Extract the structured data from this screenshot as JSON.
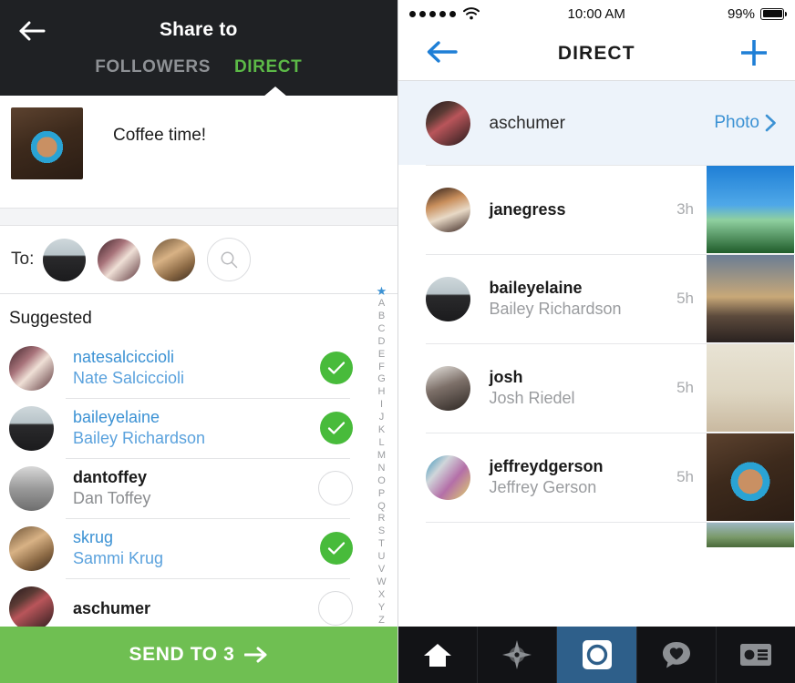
{
  "share_panel": {
    "back_icon": "arrow-left-icon",
    "title": "Share to",
    "tabs": [
      {
        "label": "FOLLOWERS",
        "active": false
      },
      {
        "label": "DIRECT",
        "active": true
      }
    ],
    "active_tab_color": "#5cba47",
    "post": {
      "caption": "Coffee time!",
      "thumbnail": "coffee-latte-photo"
    },
    "recipients": {
      "label": "To:",
      "avatars": [
        "baileyelaine-avatar",
        "natesalciccioli-avatar",
        "skrug-avatar"
      ],
      "search_icon": "search-icon"
    },
    "suggested": {
      "heading": "Suggested",
      "items": [
        {
          "username": "natesalciccioli",
          "fullname": "Nate Salciccioli",
          "selected": true
        },
        {
          "username": "baileyelaine",
          "fullname": "Bailey Richardson",
          "selected": true
        },
        {
          "username": "dantoffey",
          "fullname": "Dan Toffey",
          "selected": false
        },
        {
          "username": "skrug",
          "fullname": "Sammi Krug",
          "selected": true
        },
        {
          "username": "aschumer",
          "fullname": "",
          "selected": false
        }
      ]
    },
    "index_scrubber": {
      "star": "★",
      "letters": [
        "A",
        "B",
        "C",
        "D",
        "E",
        "F",
        "G",
        "H",
        "I",
        "J",
        "K",
        "L",
        "M",
        "N",
        "O",
        "P",
        "Q",
        "R",
        "S",
        "T",
        "U",
        "V",
        "W",
        "X",
        "Y",
        "Z"
      ]
    },
    "send_button": {
      "label": "SEND TO 3",
      "arrow_icon": "arrow-right-icon",
      "color": "#6fbf52"
    }
  },
  "direct_panel": {
    "statusbar": {
      "signal_dots": 5,
      "wifi_icon": "wifi-icon",
      "time": "10:00 AM",
      "battery_percent": "99%",
      "battery_icon": "battery-full-icon"
    },
    "navbar": {
      "back_icon": "arrow-left-icon",
      "title": "DIRECT",
      "add_icon": "plus-icon",
      "accent_color": "#1f7fd6"
    },
    "conversations": [
      {
        "username": "aschumer",
        "fullname": "",
        "meta": "Photo",
        "unread": true,
        "thumbnail": ""
      },
      {
        "username": "janegress",
        "fullname": "",
        "meta": "3h",
        "unread": false,
        "thumbnail": "palm-trees-photo"
      },
      {
        "username": "baileyelaine",
        "fullname": "Bailey Richardson",
        "meta": "5h",
        "unread": false,
        "thumbnail": "street-sunset-photo"
      },
      {
        "username": "josh",
        "fullname": "Josh Riedel",
        "meta": "5h",
        "unread": false,
        "thumbnail": "dog-on-chair-photo"
      },
      {
        "username": "jeffreydgerson",
        "fullname": "Jeffrey Gerson",
        "meta": "5h",
        "unread": false,
        "thumbnail": "coffee-latte-photo"
      }
    ],
    "tabbar": {
      "items": [
        {
          "icon": "home-icon",
          "active": false
        },
        {
          "icon": "explore-compass-icon",
          "active": false
        },
        {
          "icon": "camera-icon",
          "active": true
        },
        {
          "icon": "activity-heart-icon",
          "active": false
        },
        {
          "icon": "profile-card-icon",
          "active": false
        }
      ],
      "active_background": "#2e5f8a"
    }
  }
}
